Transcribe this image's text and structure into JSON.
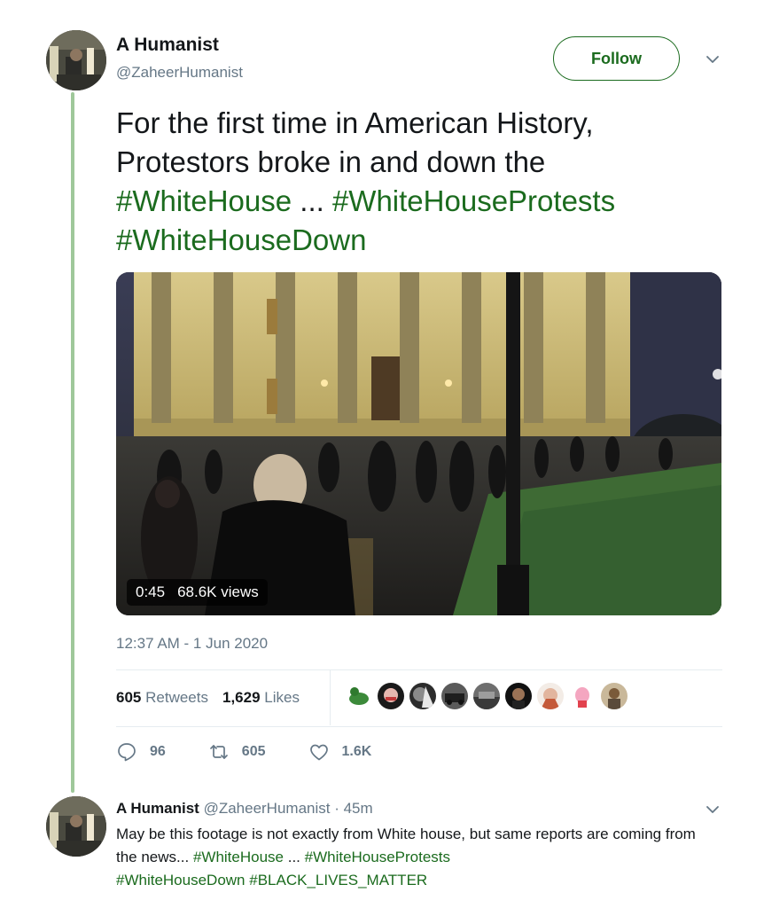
{
  "tweet": {
    "author_name": "A Humanist",
    "author_handle": "@ZaheerHumanist",
    "follow_label": "Follow",
    "text_line1": "For the first time in American History,",
    "text_line2": "Protestors broke in and down the",
    "hashtag1": "#WhiteHouse",
    "ellipsis": " ... ",
    "hashtag2": "#WhiteHouseProtests",
    "hashtag3": "#WhiteHouseDown",
    "media": {
      "duration": "0:45",
      "views": "68.6K views"
    },
    "timestamp": "12:37 AM - 1 Jun 2020",
    "stats": {
      "retweets_count": "605",
      "retweets_label": "Retweets",
      "likes_count": "1,629",
      "likes_label": "Likes"
    },
    "actions": {
      "replies": "96",
      "retweets": "605",
      "likes": "1.6K"
    },
    "icons": [
      "chevron-down-icon",
      "reply-icon",
      "retweet-icon",
      "heart-icon"
    ]
  },
  "reply": {
    "author_name": "A Humanist",
    "author_handle": "@ZaheerHumanist",
    "time": " · 45m",
    "text_part1": "May be this footage is not exactly from White house, but same reports are coming from the news... ",
    "hashtag1": "#WhiteHouse",
    "ellipsis": " ... ",
    "hashtag2": "#WhiteHouseProtests",
    "hashtag3": "#WhiteHouseDown",
    "space": " ",
    "hashtag4": "#BLACK_LIVES_MATTER"
  },
  "colors": {
    "accent": "#1b6b1e",
    "muted": "#657786",
    "thread_line": "#9fc89a"
  }
}
